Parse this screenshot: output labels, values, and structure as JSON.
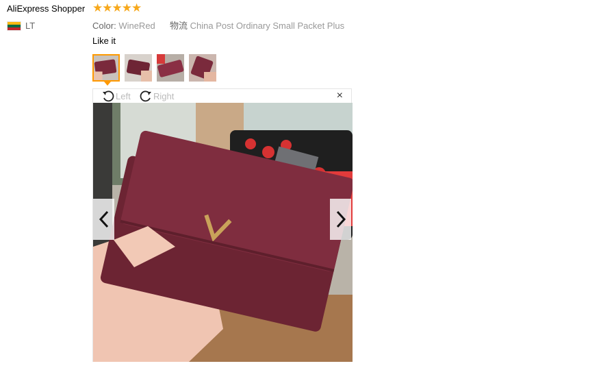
{
  "review": {
    "user_name": "AliExpress Shopper",
    "country": "LT",
    "rating": 5,
    "stars": [
      "★",
      "★",
      "★",
      "★",
      "★"
    ],
    "color_label": "Color:",
    "color_value": "WineRed",
    "shipping_label": "物流",
    "shipping_value": "China Post Ordinary Small Packet Plus",
    "comment": "Like it"
  },
  "viewer": {
    "rotate_left": "Left",
    "rotate_right": "Right",
    "close": "×",
    "prev_icon": "chevron-left-icon",
    "next_icon": "chevron-right-icon"
  },
  "thumbnails": [
    {
      "name": "photo-1",
      "active": true
    },
    {
      "name": "photo-2",
      "active": false
    },
    {
      "name": "photo-3",
      "active": false
    },
    {
      "name": "photo-4",
      "active": false
    }
  ],
  "colors": {
    "star": "#f7a81b",
    "active_border": "#ff9900",
    "wallet": "#7a2a3c",
    "flag": [
      "#fdb913",
      "#006a44",
      "#c1272d"
    ]
  }
}
